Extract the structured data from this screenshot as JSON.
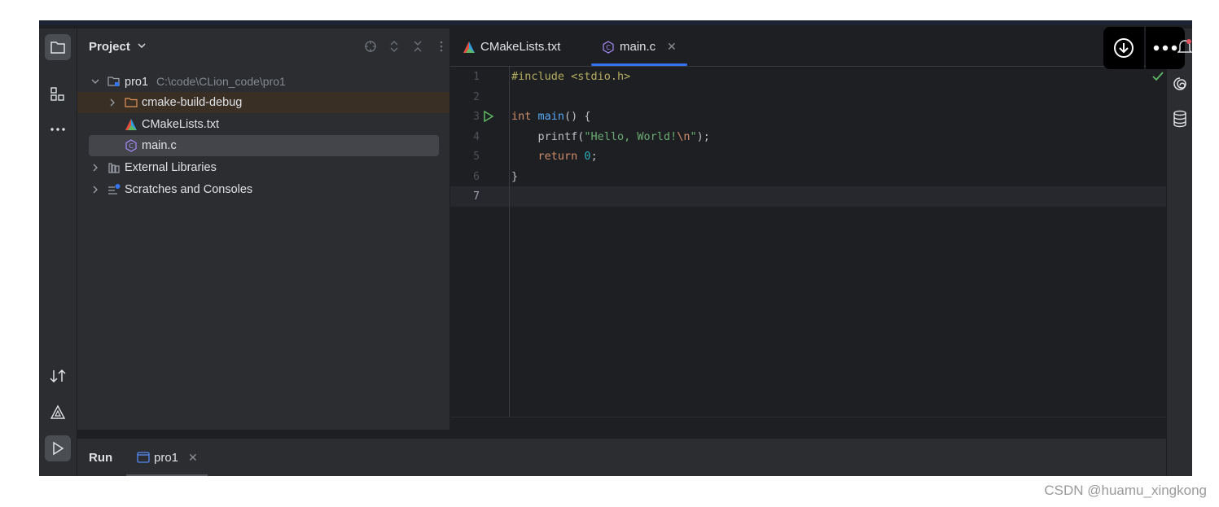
{
  "project_panel": {
    "title": "Project",
    "tree": {
      "root_name": "pro1",
      "root_path": "C:\\code\\CLion_code\\pro1",
      "items": [
        {
          "label": "cmake-build-debug"
        },
        {
          "label": "CMakeLists.txt"
        },
        {
          "label": "main.c"
        },
        {
          "label": "External Libraries"
        },
        {
          "label": "Scratches and Consoles"
        }
      ]
    }
  },
  "editor": {
    "tabs": [
      {
        "label": "CMakeLists.txt",
        "icon": "cmake-icon"
      },
      {
        "label": "main.c",
        "icon": "c-file-icon",
        "active": true
      }
    ],
    "line_numbers": [
      "1",
      "2",
      "3",
      "4",
      "5",
      "6",
      "7"
    ],
    "current_line": "7",
    "code_lines": [
      [
        {
          "cls": "pp",
          "text": "#include <stdio.h>"
        }
      ],
      [],
      [
        {
          "cls": "kw",
          "text": "int "
        },
        {
          "cls": "fn",
          "text": "main"
        },
        {
          "cls": "",
          "text": "() {"
        }
      ],
      [
        {
          "cls": "",
          "text": "    printf("
        },
        {
          "cls": "str",
          "text": "\"Hello, World!"
        },
        {
          "cls": "kw",
          "text": "\\n"
        },
        {
          "cls": "str",
          "text": "\""
        },
        {
          "cls": "",
          "text": ");"
        }
      ],
      [
        {
          "cls": "",
          "text": "    "
        },
        {
          "cls": "kw",
          "text": "return "
        },
        {
          "cls": "num",
          "text": "0"
        },
        {
          "cls": "",
          "text": ";"
        }
      ],
      [
        {
          "cls": "",
          "text": "}"
        }
      ],
      []
    ]
  },
  "run_panel": {
    "title": "Run",
    "tab_label": "pro1"
  },
  "watermark": "CSDN @huamu_xingkong",
  "colors": {
    "accent": "#3574f0",
    "run_green": "#5fb865",
    "check_green": "#5fb865"
  }
}
